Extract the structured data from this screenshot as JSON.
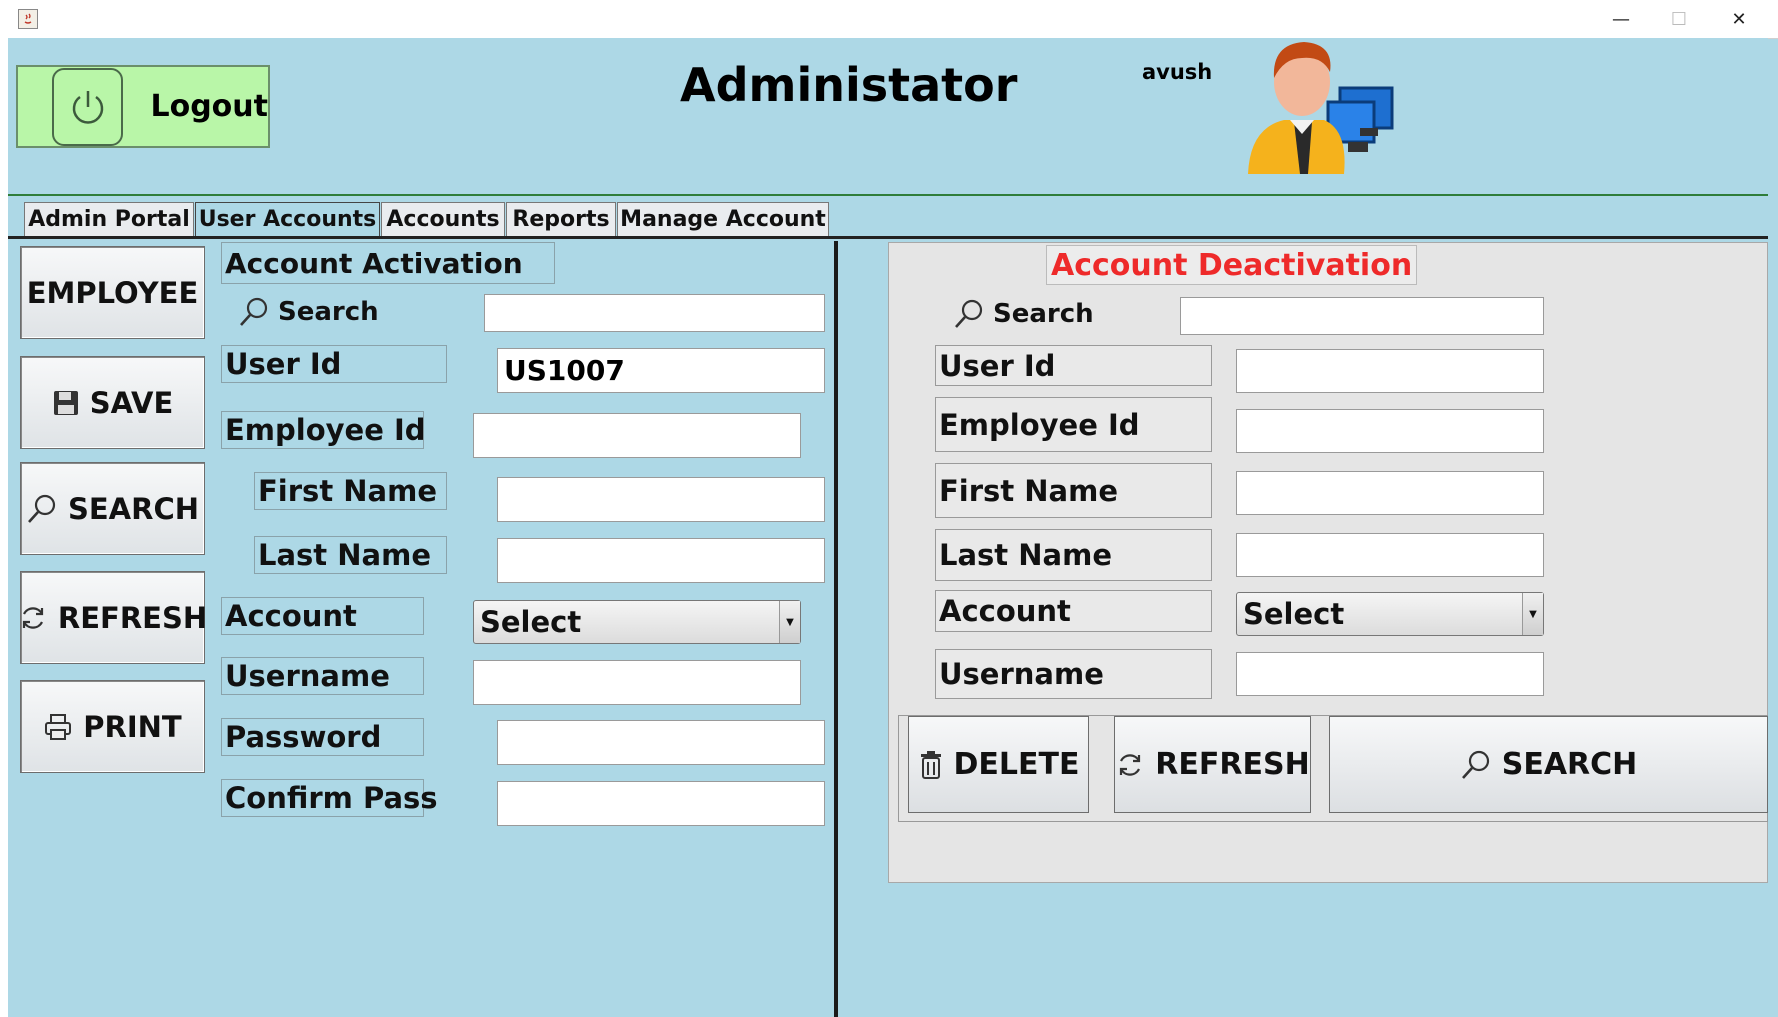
{
  "window": {
    "title": "",
    "minimize": "—",
    "maximize": "☐",
    "close": "✕"
  },
  "header": {
    "logout_label": "Logout",
    "title": "Administator",
    "username": "avush"
  },
  "tabs": [
    {
      "label": "Admin Portal",
      "active": false
    },
    {
      "label": "User Accounts",
      "active": true
    },
    {
      "label": "Accounts",
      "active": false
    },
    {
      "label": "Reports",
      "active": false
    },
    {
      "label": "Manage Account",
      "active": false
    }
  ],
  "side_buttons": {
    "employee": "EMPLOYEE",
    "save": "SAVE",
    "search": "SEARCH",
    "refresh": "REFRESH",
    "print": "PRINT"
  },
  "activation": {
    "title": "Account Activation",
    "search_label": "Search",
    "search_value": "",
    "user_id_label": "User Id",
    "user_id_value": "US1007",
    "employee_id_label": "Employee Id",
    "first_name_label": "First Name",
    "last_name_label": "Last Name",
    "account_label": "Account",
    "account_selected": "Select",
    "username_label": "Username",
    "password_label": "Password",
    "confirm_label": "Confirm Pass"
  },
  "deactivation": {
    "title": "Account Deactivation",
    "search_label": "Search",
    "user_id_label": "User Id",
    "employee_id_label": "Employee Id",
    "first_name_label": "First Name",
    "last_name_label": "Last Name",
    "account_label": "Account",
    "account_selected": "Select",
    "username_label": "Username",
    "delete_label": "DELETE",
    "refresh_label": "REFRESH",
    "search_button_label": "SEARCH"
  },
  "colors": {
    "background": "#add8e6",
    "logout_bg": "#b9f6a8",
    "deactivation_title": "#ee2a2a"
  }
}
